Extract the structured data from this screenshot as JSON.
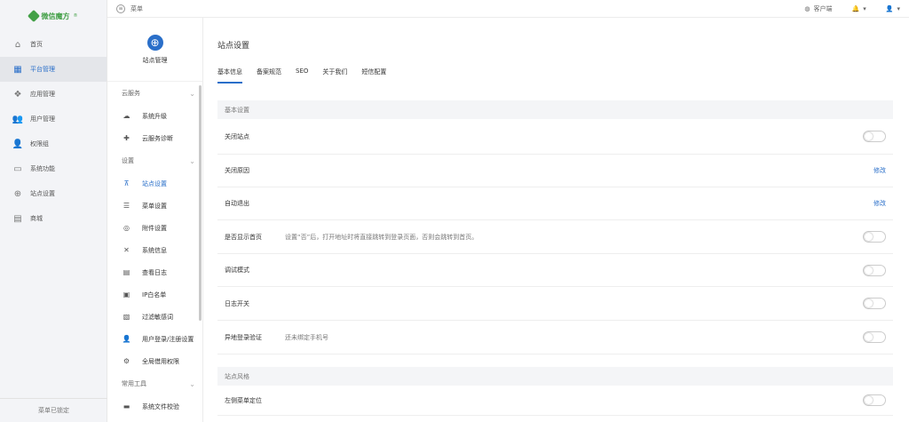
{
  "brand": {
    "name": "微信魔方",
    "sup": "®"
  },
  "sidebar": {
    "items": [
      {
        "label": "首页",
        "icon": "home-icon"
      },
      {
        "label": "平台管理",
        "icon": "grid-icon",
        "active": true
      },
      {
        "label": "应用管理",
        "icon": "apps-icon"
      },
      {
        "label": "用户管理",
        "icon": "users-icon"
      },
      {
        "label": "权限组",
        "icon": "user-icon"
      },
      {
        "label": "系统功能",
        "icon": "monitor-icon"
      },
      {
        "label": "站点设置",
        "icon": "globe-icon"
      },
      {
        "label": "商城",
        "icon": "store-icon"
      }
    ],
    "footer": "菜单已锁定"
  },
  "topbar": {
    "menu_label": "菜单",
    "client_label": "客户端",
    "bell_caret": "▾",
    "user_caret": "▾"
  },
  "subnav": {
    "title": "站点管理",
    "groups": [
      {
        "label": "云服务",
        "items": [
          {
            "label": "系统升级",
            "icon": "cloud-upload-icon"
          },
          {
            "label": "云服务诊断",
            "icon": "medkit-icon"
          }
        ]
      },
      {
        "label": "设置",
        "items": [
          {
            "label": "站点设置",
            "icon": "sitemap-icon",
            "active": true
          },
          {
            "label": "菜单设置",
            "icon": "list-icon"
          },
          {
            "label": "附件设置",
            "icon": "attachment-icon"
          },
          {
            "label": "系统信息",
            "icon": "tools-icon"
          },
          {
            "label": "查看日志",
            "icon": "log-icon"
          },
          {
            "label": "IP白名单",
            "icon": "ip-icon"
          },
          {
            "label": "过滤敏感词",
            "icon": "filter-icon"
          },
          {
            "label": "用户登录/注册设置",
            "icon": "user-icon"
          },
          {
            "label": "全局借用权限",
            "icon": "key-icon"
          }
        ]
      },
      {
        "label": "常用工具",
        "items": [
          {
            "label": "系统文件校验",
            "icon": "folder-icon"
          }
        ]
      }
    ]
  },
  "main": {
    "title": "站点设置",
    "tabs": [
      "基本信息",
      "备案规范",
      "SEO",
      "关于我们",
      "短信配置"
    ],
    "sections": [
      {
        "label": "基本设置",
        "rows": [
          {
            "label": "关闭站点",
            "desc": "",
            "control": "toggle"
          },
          {
            "label": "关闭原因",
            "desc": "",
            "control": "link",
            "link": "修改"
          },
          {
            "label": "自动退出",
            "desc": "",
            "control": "link",
            "link": "修改"
          },
          {
            "label": "是否显示首页",
            "desc": "设置“否”后，打开地址时将直接跳转到登录页面，否则会跳转到首页。",
            "control": "toggle"
          },
          {
            "label": "调试模式",
            "desc": "",
            "control": "toggle"
          },
          {
            "label": "日志开关",
            "desc": "",
            "control": "toggle"
          },
          {
            "label": "异地登录验证",
            "desc": "还未绑定手机号",
            "control": "toggle"
          }
        ]
      },
      {
        "label": "站点风格",
        "rows": [
          {
            "label": "左侧菜单定位",
            "desc": "",
            "control": "toggle"
          }
        ]
      }
    ]
  }
}
